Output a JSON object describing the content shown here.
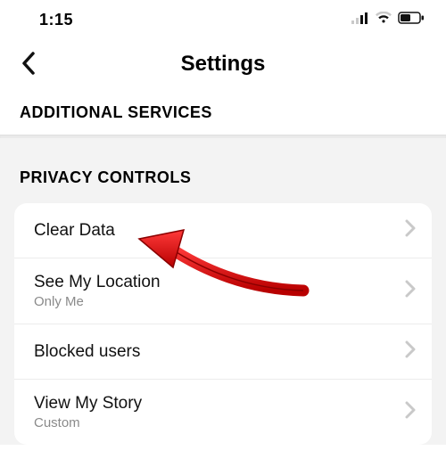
{
  "status": {
    "time": "1:15"
  },
  "header": {
    "title": "Settings"
  },
  "sections": {
    "additional_services_label": "ADDITIONAL SERVICES",
    "privacy_controls_label": "PRIVACY CONTROLS"
  },
  "privacy_rows": [
    {
      "title": "Clear Data"
    },
    {
      "title": "See My Location",
      "sub": "Only Me"
    },
    {
      "title": "Blocked users"
    },
    {
      "title": "View My Story",
      "sub": "Custom"
    }
  ]
}
